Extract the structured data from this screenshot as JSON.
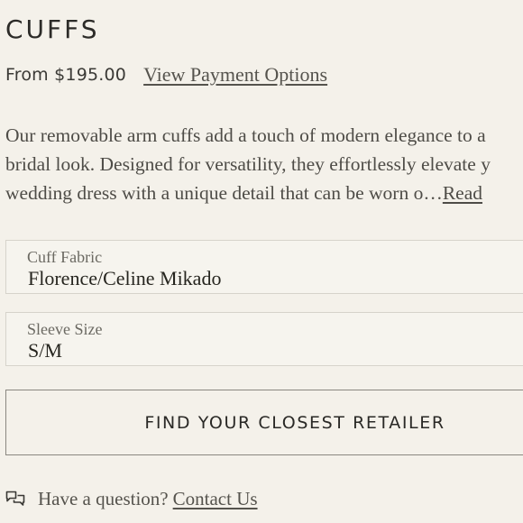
{
  "product": {
    "title": "CUFFS",
    "price": "From $195.00",
    "payment_link": "View Payment Options"
  },
  "description": {
    "lines": [
      "Our removable arm cuffs add a touch of modern elegance to a",
      "bridal look. Designed for versatility, they effortlessly elevate y",
      "wedding dress with a unique detail that can be worn o…"
    ],
    "read_more": "Read"
  },
  "options": {
    "fabric": {
      "label": "Cuff Fabric",
      "value": "Florence/Celine Mikado"
    },
    "size": {
      "label": "Sleeve Size",
      "value": "S/M"
    }
  },
  "retailer_button": {
    "label": "FIND YOUR CLOSEST RETAILER"
  },
  "question": {
    "icon": "chat-bubble-icon",
    "text": "Have a question?",
    "link": "Contact Us"
  },
  "colors": {
    "background": "#f4f1ea",
    "text": "#2a2926",
    "border": "#8a8780"
  }
}
